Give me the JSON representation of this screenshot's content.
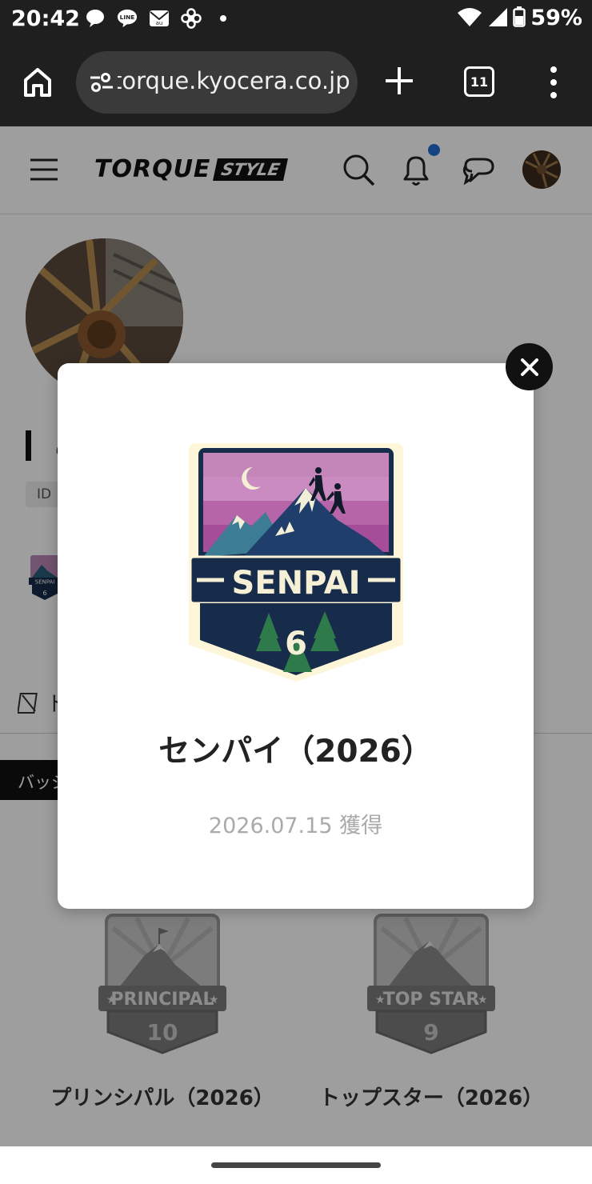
{
  "status_bar": {
    "time": "20:42",
    "notification_icons": [
      "chat-bubble-icon",
      "line-app-icon",
      "mail-icon",
      "pinwheel-icon",
      "dot-icon"
    ],
    "battery": "59%"
  },
  "browser": {
    "url": "torque.kyocera.co.jp",
    "tab_count": "11"
  },
  "site": {
    "logo_text": "TORQUE",
    "logo_badge": "STYLE"
  },
  "profile": {
    "name_fragment": "こ",
    "id_label": "ID",
    "link_fragment": "ト"
  },
  "badges_tab": {
    "label": "バッジ"
  },
  "badges": [
    {
      "label": "プリンシパル（2026）",
      "banner": "PRINCIPAL",
      "number": "10"
    },
    {
      "label": "トップスター（2026）",
      "banner": "TOP STAR",
      "number": "9"
    }
  ],
  "modal": {
    "badge_banner": "SENPAI",
    "badge_number": "6",
    "title": "センパイ（2026）",
    "acquired": "2026.07.15 獲得"
  },
  "colors": {
    "badge_navy": "#172b4a",
    "badge_sky": "#c47fb6",
    "notification_dot": "#1f6fd1"
  }
}
